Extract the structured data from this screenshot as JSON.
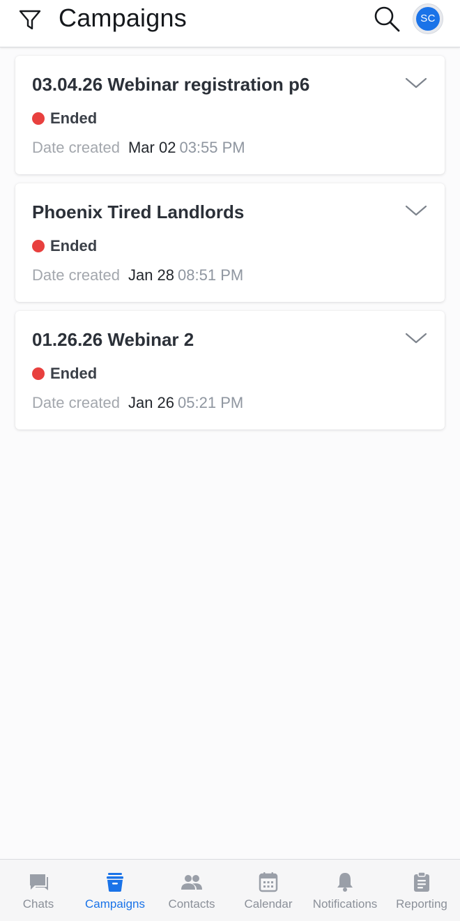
{
  "header": {
    "title": "Campaigns",
    "avatar_initials": "SC",
    "icons": {
      "filter": "filter-icon",
      "search": "search-icon"
    }
  },
  "campaigns": [
    {
      "title": "03.04.26 Webinar registration p6",
      "status": "Ended",
      "date_label": "Date created",
      "date": "Mar 02",
      "time": "03:55 PM"
    },
    {
      "title": "Phoenix Tired Landlords",
      "status": "Ended",
      "date_label": "Date created",
      "date": "Jan 28",
      "time": "08:51 PM"
    },
    {
      "title": "01.26.26 Webinar 2",
      "status": "Ended",
      "date_label": "Date created",
      "date": "Jan 26",
      "time": "05:21 PM"
    }
  ],
  "nav": {
    "items": [
      {
        "label": "Chats",
        "icon": "chat-icon",
        "active": false
      },
      {
        "label": "Campaigns",
        "icon": "campaign-icon",
        "active": true
      },
      {
        "label": "Contacts",
        "icon": "contacts-icon",
        "active": false
      },
      {
        "label": "Calendar",
        "icon": "calendar-icon",
        "active": false
      },
      {
        "label": "Notifications",
        "icon": "bell-icon",
        "active": false
      },
      {
        "label": "Reporting",
        "icon": "clipboard-icon",
        "active": false
      }
    ]
  },
  "colors": {
    "accent": "#1a73e8",
    "status_ended": "#e8403e",
    "nav_inactive": "#8b9099",
    "nav_icon_inactive": "#9a9fa8"
  }
}
